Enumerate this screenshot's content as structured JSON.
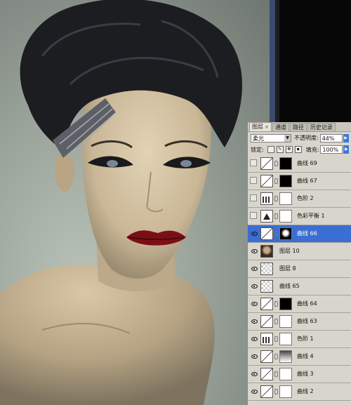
{
  "panel": {
    "tabs": [
      {
        "label": "图层",
        "close": "×",
        "active": true
      },
      {
        "label": "通道",
        "active": false
      },
      {
        "label": "路径",
        "active": false
      },
      {
        "label": "历史记录",
        "active": false
      }
    ],
    "blend_mode": "柔光",
    "opacity_label": "不透明度:",
    "opacity_value": "44%",
    "lock_label": "锁定:",
    "fill_label": "填充:",
    "fill_value": "100%"
  },
  "layers": [
    {
      "name": "曲线 69",
      "visible": false,
      "thumb": "curves",
      "mask": "black",
      "selected": false
    },
    {
      "name": "曲线 67",
      "visible": false,
      "thumb": "curves",
      "mask": "black",
      "selected": false
    },
    {
      "name": "色阶 2",
      "visible": false,
      "thumb": "levels",
      "mask": "white",
      "selected": false
    },
    {
      "name": "色彩平衡 1",
      "visible": false,
      "thumb": "balance",
      "mask": "white",
      "selected": false
    },
    {
      "name": "曲线 66",
      "visible": true,
      "thumb": "curves",
      "mask": "mix",
      "selected": true
    },
    {
      "name": "图层 10",
      "visible": true,
      "thumb": "photo",
      "mask": "none",
      "selected": false
    },
    {
      "name": "图层 8",
      "visible": true,
      "thumb": "checker",
      "mask": "none",
      "selected": false
    },
    {
      "name": "曲线 65",
      "visible": true,
      "thumb": "checker",
      "mask": "none",
      "selected": false
    },
    {
      "name": "曲线 64",
      "visible": true,
      "thumb": "curves",
      "mask": "black",
      "selected": false
    },
    {
      "name": "曲线 63",
      "visible": true,
      "thumb": "curves",
      "mask": "white",
      "selected": false
    },
    {
      "name": "色阶 1",
      "visible": true,
      "thumb": "levels",
      "mask": "white",
      "selected": false
    },
    {
      "name": "曲线 4",
      "visible": true,
      "thumb": "curves",
      "mask": "grey",
      "selected": false
    },
    {
      "name": "曲线 3",
      "visible": true,
      "thumb": "curves",
      "mask": "white",
      "selected": false
    },
    {
      "name": "曲线 2",
      "visible": true,
      "thumb": "curves",
      "mask": "white",
      "selected": false
    }
  ],
  "colors": {
    "selection": "#3a6ed2",
    "panel_bg": "#d8d5cc"
  }
}
